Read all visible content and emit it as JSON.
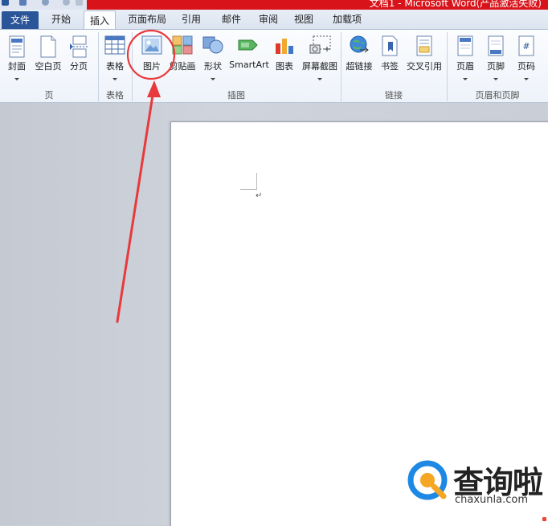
{
  "window": {
    "title": "文档1 - Microsoft Word(产品激活失败)"
  },
  "tabs": [
    {
      "label": "文件",
      "kind": "file"
    },
    {
      "label": "开始"
    },
    {
      "label": "插入",
      "active": true
    },
    {
      "label": "页面布局"
    },
    {
      "label": "引用"
    },
    {
      "label": "邮件"
    },
    {
      "label": "审阅"
    },
    {
      "label": "视图"
    },
    {
      "label": "加载项"
    }
  ],
  "ribbon": {
    "buttons": [
      {
        "label": "封面",
        "icon": "cover-page-icon",
        "has_dropdown": true
      },
      {
        "label": "空白页",
        "icon": "blank-page-icon"
      },
      {
        "label": "分页",
        "icon": "page-break-icon"
      },
      {
        "label": "表格",
        "icon": "table-icon",
        "has_dropdown": true
      },
      {
        "label": "图片",
        "icon": "picture-icon",
        "highlighted": true
      },
      {
        "label": "剪贴画",
        "icon": "clip-art-icon"
      },
      {
        "label": "形状",
        "icon": "shapes-icon",
        "has_dropdown": true
      },
      {
        "label": "SmartArt",
        "icon": "smartart-icon"
      },
      {
        "label": "图表",
        "icon": "chart-icon"
      },
      {
        "label": "屏幕截图",
        "icon": "screenshot-icon",
        "has_dropdown": true
      },
      {
        "label": "超链接",
        "icon": "hyperlink-icon"
      },
      {
        "label": "书签",
        "icon": "bookmark-icon"
      },
      {
        "label": "交叉引用",
        "icon": "cross-reference-icon"
      },
      {
        "label": "页眉",
        "icon": "header-icon",
        "has_dropdown": true
      },
      {
        "label": "页脚",
        "icon": "footer-icon",
        "has_dropdown": true
      },
      {
        "label": "页码",
        "icon": "page-number-icon",
        "has_dropdown": true
      }
    ],
    "groups": [
      {
        "label": "页"
      },
      {
        "label": "表格"
      },
      {
        "label": "插图"
      },
      {
        "label": "链接"
      },
      {
        "label": "页眉和页脚"
      }
    ]
  },
  "document": {
    "paragraph_mark": "↵"
  },
  "annotation": {
    "color": "#e8393b"
  },
  "watermark": {
    "brand": "查询啦",
    "url": "chaxunla.com",
    "accent": "#1e88e5",
    "accent2": "#f5a623"
  },
  "colors": {
    "file_tab": "#2a5699",
    "title_red": "#d8141a"
  }
}
